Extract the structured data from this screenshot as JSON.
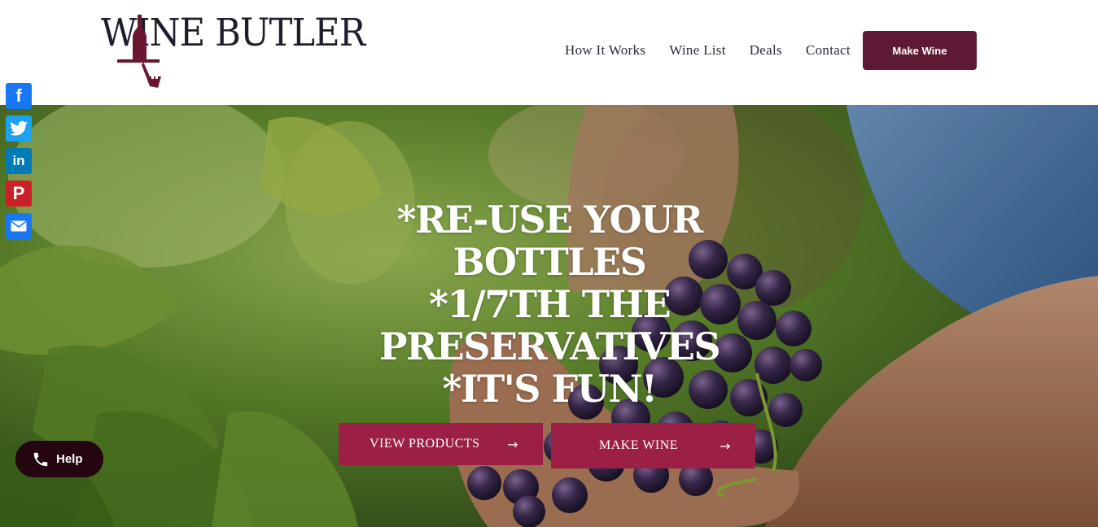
{
  "brand": {
    "logo_text": "WINE BUTLER"
  },
  "nav": {
    "links": [
      "How It Works",
      "Wine List",
      "Deals",
      "Contact"
    ],
    "cta": "Make Wine"
  },
  "hero": {
    "headline_lines": [
      "*RE-USE YOUR",
      "BOTTLES",
      "*1/7TH THE",
      "PRESERVATIVES",
      "*IT'S FUN!"
    ],
    "buttons": {
      "view_products": "VIEW PRODUCTS",
      "make_wine": "MAKE WINE",
      "arrow": "→"
    }
  },
  "social": {
    "icons": [
      "facebook-icon",
      "twitter-icon",
      "linkedin-icon",
      "pinterest-icon",
      "email-icon"
    ],
    "glyphs": {
      "facebook": "f",
      "linkedin": "in",
      "pinterest": "P"
    }
  },
  "help": {
    "label": "Help"
  },
  "colors": {
    "brand_wine": "#5e1a34",
    "button_crimson": "#9c2046",
    "help_bg": "#240510",
    "facebook": "#1877f2",
    "twitter": "#1da1f2",
    "linkedin": "#007bb5",
    "pinterest": "#cb2027"
  }
}
